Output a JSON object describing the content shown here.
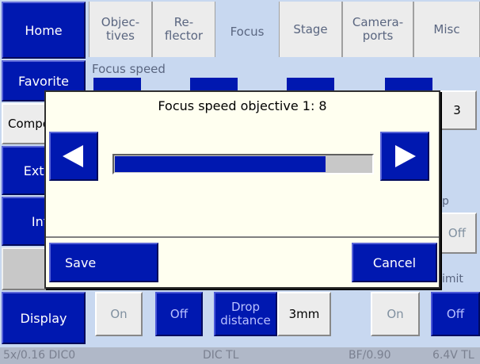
{
  "nav": {
    "home": "Home",
    "favorite": "Favorite",
    "components": "Components",
    "extras": "Extras",
    "info": "Info",
    "display": "Display"
  },
  "tabs": [
    {
      "label": "Objec-\ntives"
    },
    {
      "label": "Re-\nflector"
    },
    {
      "label": "Focus"
    },
    {
      "label": "Stage"
    },
    {
      "label": "Camera-\nports"
    },
    {
      "label": "Misc"
    }
  ],
  "content": {
    "focus_speed_heading": "Focus speed",
    "right_value_button": "3",
    "right_label_1": "p",
    "right_off_button": "Off",
    "right_label_2": "imit",
    "bottom_row": {
      "on_1": "On",
      "off_1": "Off",
      "drop_distance": "Drop\ndistance",
      "drop_value": "3mm",
      "on_2": "On",
      "off_2": "Off"
    }
  },
  "status_bar": {
    "objective": "5x/0.16 DIC0",
    "reflector": "DIC TL",
    "condenser": "BF/0.90",
    "voltage": "6.4V TL"
  },
  "dialog": {
    "title": "Focus speed objective 1: 8",
    "slider_fraction": 0.82,
    "save": "Save",
    "cancel": "Cancel"
  }
}
